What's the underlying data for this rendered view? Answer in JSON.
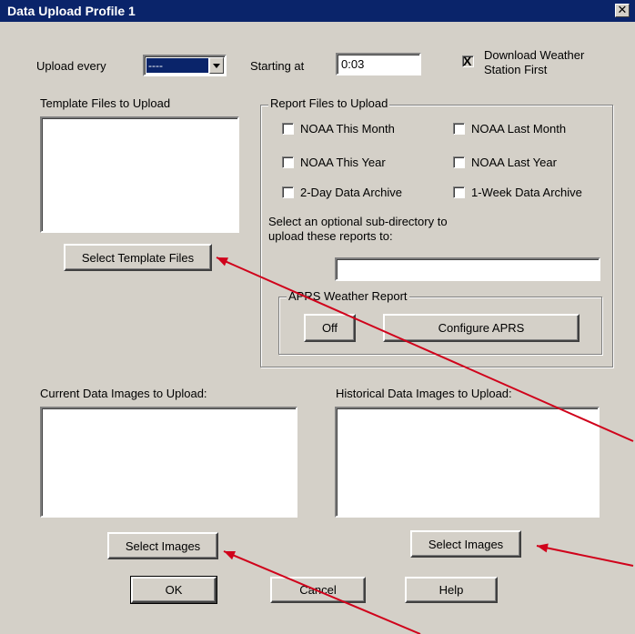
{
  "window": {
    "title": "Data Upload Profile 1",
    "close_glyph": "✕"
  },
  "schedule": {
    "upload_every_label": "Upload every",
    "upload_every_value": "----",
    "starting_at_label": "Starting at",
    "starting_at_value": "0:03",
    "download_first_line1": "Download Weather",
    "download_first_line2": "Station First",
    "download_first_checked": true
  },
  "template": {
    "label": "Template Files to Upload",
    "select_button": "Select Template Files"
  },
  "reports": {
    "group_label": "Report Files to Upload",
    "checkboxes": [
      {
        "label": "NOAA This Month",
        "checked": false
      },
      {
        "label": "NOAA Last Month",
        "checked": false
      },
      {
        "label": "NOAA This Year",
        "checked": false
      },
      {
        "label": "NOAA Last Year",
        "checked": false
      },
      {
        "label": "2-Day Data Archive",
        "checked": false
      },
      {
        "label": "1-Week Data Archive",
        "checked": false
      }
    ],
    "subdir_line1": "Select an optional sub-directory to",
    "subdir_line2": "upload these reports to:",
    "subdir_value": ""
  },
  "aprs": {
    "group_label": "APRS Weather Report",
    "toggle_button": "Off",
    "configure_button": "Configure APRS"
  },
  "current_images": {
    "label": "Current Data Images to Upload:",
    "select_button": "Select Images"
  },
  "historical_images": {
    "label": "Historical Data Images to Upload:",
    "select_button": "Select Images"
  },
  "footer": {
    "ok": "OK",
    "cancel": "Cancel",
    "help": "Help"
  },
  "colors": {
    "dialog_bg": "#d4d0c8",
    "titlebar_bg": "#0a246a",
    "annotation_arrow": "#d0021b"
  },
  "icons": [
    "close-icon",
    "dropdown-arrow-icon",
    "checkbox-check-icon"
  ]
}
